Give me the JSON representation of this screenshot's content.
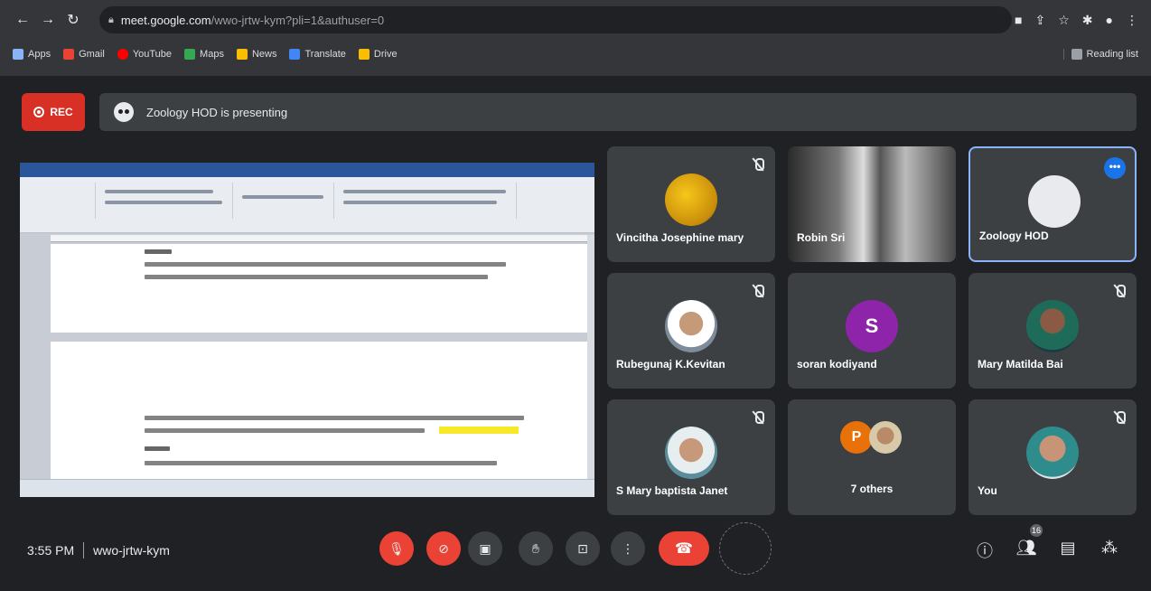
{
  "browser": {
    "url_host": "meet.google.com",
    "url_rest": "/wwo-jrtw-kym?pli=1&authuser=0",
    "bookmarks": [
      "Apps",
      "Gmail",
      "YouTube",
      "Maps",
      "News",
      "Translate",
      "Drive"
    ],
    "reading_list": "Reading list"
  },
  "meet": {
    "rec_label": "REC",
    "presenting_text": "Zoology HOD is presenting",
    "tiles": [
      {
        "name": "Vincitha Josephine mary",
        "muted": true
      },
      {
        "name": "Robin Sri",
        "muted": false
      },
      {
        "name": "Zoology HOD",
        "muted": false
      },
      {
        "name": "Rubegunaj K.Kevitan",
        "muted": true
      },
      {
        "name": "soran kodiyand",
        "muted": false,
        "initial": "S"
      },
      {
        "name": "Mary Matilda Bai",
        "muted": true
      },
      {
        "name": "S Mary baptista Janet",
        "muted": true
      },
      {
        "name": "7 others",
        "muted": false,
        "initial": "P"
      },
      {
        "name": "You",
        "muted": true
      }
    ],
    "time": "3:55 PM",
    "meeting_code": "wwo-jrtw-kym",
    "people_count": "16"
  },
  "colors": {
    "rec": "#d93025",
    "accent": "#8ab4f8",
    "end_call": "#ea4335"
  }
}
